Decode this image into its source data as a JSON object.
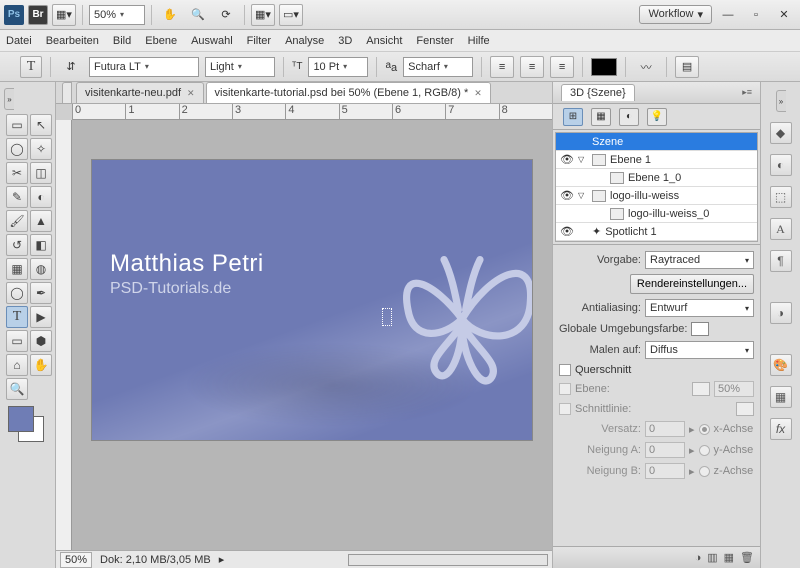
{
  "titlebar": {
    "zoom": "50%",
    "workspace_label": "Workflow",
    "ps": "Ps",
    "br": "Br"
  },
  "menubar": [
    "Datei",
    "Bearbeiten",
    "Bild",
    "Ebene",
    "Auswahl",
    "Filter",
    "Analyse",
    "3D",
    "Ansicht",
    "Fenster",
    "Hilfe"
  ],
  "options": {
    "font_family": "Futura LT",
    "font_style": "Light",
    "font_size": "10 Pt",
    "aa_label": "Scharf"
  },
  "tabs": [
    {
      "label": "visitenkarte-neu.pdf",
      "active": false
    },
    {
      "label": "visitenkarte-tutorial.psd bei 50% (Ebene 1, RGB/8) *",
      "active": true
    }
  ],
  "ruler_marks": [
    "0",
    "1",
    "2",
    "3",
    "4",
    "5",
    "6",
    "7",
    "8"
  ],
  "canvas": {
    "name": "Matthias Petri",
    "site": "PSD-Tutorials.de"
  },
  "status": {
    "zoom": "50%",
    "doc": "Dok: 2,10 MB/3,05 MB"
  },
  "panel_3d": {
    "title": "3D {Szene}",
    "tree": [
      {
        "label": "Szene",
        "selected": true,
        "level": 0,
        "eye": true,
        "arrow": "",
        "icon": false
      },
      {
        "label": "Ebene 1",
        "level": 0,
        "eye": true,
        "arrow": "▽",
        "icon": true
      },
      {
        "label": "Ebene 1_0",
        "level": 1,
        "eye": false,
        "arrow": "",
        "icon": true
      },
      {
        "label": "logo-illu-weiss",
        "level": 0,
        "eye": true,
        "arrow": "▽",
        "icon": true
      },
      {
        "label": "logo-illu-weiss_0",
        "level": 1,
        "eye": false,
        "arrow": "",
        "icon": true
      },
      {
        "label": "Spotlicht 1",
        "level": 0,
        "eye": true,
        "arrow": "",
        "icon": false,
        "light": true
      }
    ],
    "vorgabe_label": "Vorgabe:",
    "vorgabe_value": "Raytraced",
    "render_btn": "Rendereinstellungen...",
    "aa_label": "Antialiasing:",
    "aa_value": "Entwurf",
    "env_label": "Globale Umgebungsfarbe:",
    "paint_label": "Malen auf:",
    "paint_value": "Diffus",
    "cross_label": "Querschnitt",
    "ebene_label": "Ebene:",
    "ebene_percent": "50%",
    "schnitt_label": "Schnittlinie:",
    "versatz_label": "Versatz:",
    "versatz_value": "0",
    "x_achse": "x-Achse",
    "neigungA_label": "Neigung A:",
    "neigungA_value": "0",
    "y_achse": "y-Achse",
    "neigungB_label": "Neigung B:",
    "neigungB_value": "0",
    "z_achse": "z-Achse"
  }
}
